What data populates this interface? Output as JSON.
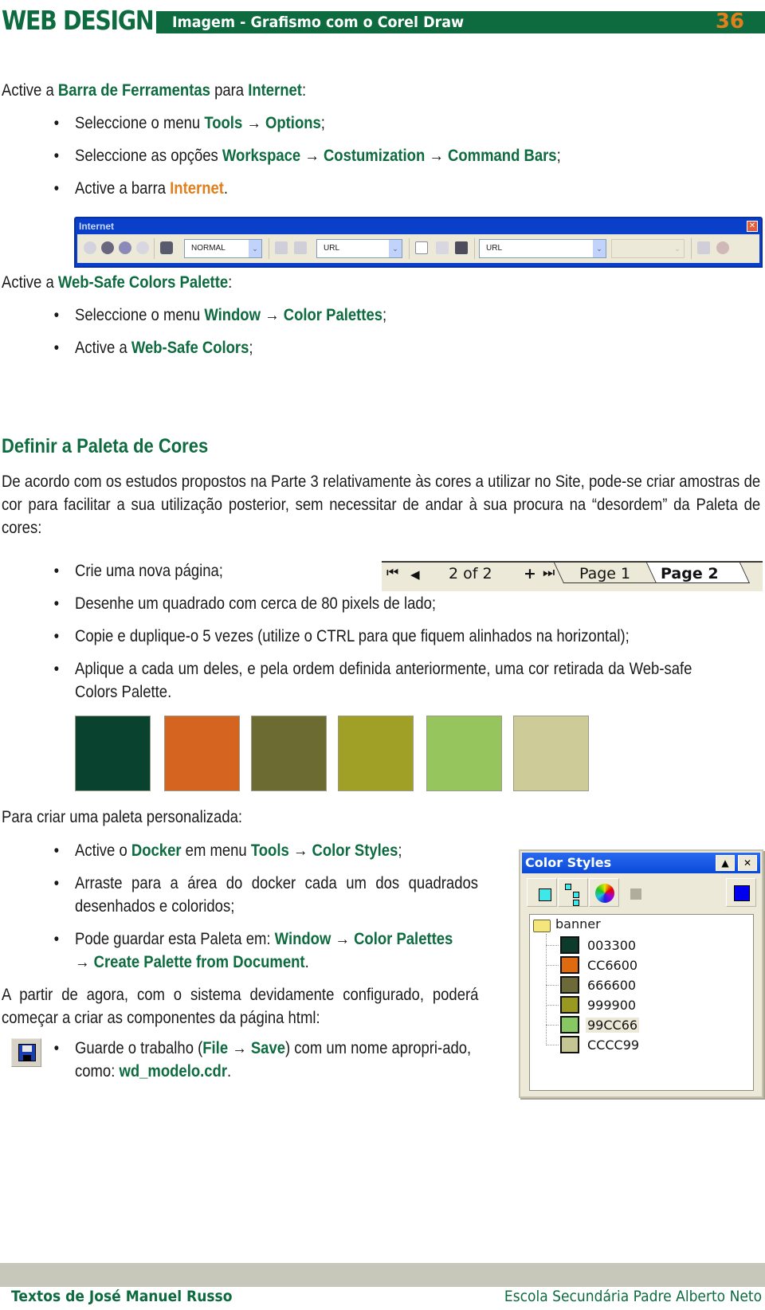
{
  "header": {
    "brand": "WEB DESIGN",
    "subtitle": "Imagem - Grafismo com o Corel Draw",
    "page_number": "36"
  },
  "section1": {
    "intro": [
      "Active a ",
      "Barra de Ferramentas",
      " para ",
      "Internet",
      ":"
    ],
    "bullets": [
      [
        "Seleccione o menu ",
        "Tools",
        " → ",
        "Options",
        ";"
      ],
      [
        "Seleccione as opções ",
        "Workspace",
        " → ",
        "Costumization",
        " → ",
        "Command Bars",
        ";"
      ],
      [
        "Active a barra ",
        "Internet",
        "."
      ]
    ]
  },
  "internet_toolbar": {
    "title": "Internet",
    "close_glyph": "✕",
    "combo_style": "NORMAL",
    "combo_url_icon_label": "URL",
    "combo_url": "URL",
    "dropdown_glyph": "⌄"
  },
  "section2": {
    "intro": [
      "Active a ",
      "Web-Safe Colors Palette",
      ":"
    ],
    "bullets": [
      [
        "Seleccione o menu ",
        "Window",
        " → ",
        "Color Palettes",
        ";"
      ],
      [
        "Active a ",
        "Web-Safe Colors",
        ";"
      ]
    ]
  },
  "section3": {
    "heading": "Definir a Paleta de Cores",
    "paragraph": "De acordo com os estudos propostos na Parte 3 relativamente às cores a utilizar no Site, pode-se criar amostras de cor para facilitar a sua utilização posterior, sem necessitar de andar à sua procura na “desordem” da Paleta de cores:",
    "bullets": [
      "Crie uma nova página;",
      "Desenhe um quadrado com cerca de 80 pixels de lado;",
      "Copie e duplique-o 5 vezes (utilize o CTRL para que fiquem alinhados na horizontal);",
      "Aplique a cada um deles, e pela ordem definida anteriormente, uma cor retirada da Web-safe Colors Palette."
    ]
  },
  "page_navigator": {
    "first_glyph": "⏮",
    "prev_glyph": "◀",
    "counter": "2 of 2",
    "add_glyph": "+",
    "last_glyph": "⏭",
    "tabs": [
      "Page 1",
      "Page 2"
    ],
    "active_tab": "Page 2"
  },
  "swatches": [
    "#0a4230",
    "#d46420",
    "#6c6b32",
    "#a0a027",
    "#96c55e",
    "#cdcb98"
  ],
  "section4": {
    "intro": "Para criar uma paleta personalizada:",
    "bullets": [
      [
        "Active o ",
        "Docker",
        " em menu ",
        "Tools",
        " → ",
        "Color Styles",
        ";"
      ],
      [
        "Arraste para a área do docker cada um dos quadrados desenhados e coloridos;"
      ],
      [
        "Pode guardar esta Paleta em: ",
        "Window",
        " → ",
        "Color Palettes",
        " → ",
        "Create Palette from Document",
        "."
      ]
    ]
  },
  "color_styles": {
    "title": "Color Styles",
    "up_glyph": "▲",
    "close_glyph": "✕",
    "folder": "banner",
    "items": [
      {
        "label": "003300",
        "color": "#0c3b2c"
      },
      {
        "label": "CC6600",
        "color": "#e06a10"
      },
      {
        "label": "666600",
        "color": "#6b6a38"
      },
      {
        "label": "999900",
        "color": "#999922"
      },
      {
        "label": "99CC66",
        "color": "#88c862"
      },
      {
        "label": "CCCC99",
        "color": "#c6c695"
      }
    ],
    "selected": "99CC66"
  },
  "section5": {
    "paragraph": "A partir de agora, com o sistema devidamente configurado, poderá começar a criar as componentes da página html:",
    "bullet": [
      "Guarde o trabalho (",
      "File",
      " → ",
      "Save",
      ") com um nome apropri-ado, como: ",
      "wd_modelo.cdr",
      "."
    ]
  },
  "footer": {
    "left": "Textos de José Manuel Russo",
    "right": "Escola Secundária Padre Alberto Neto"
  },
  "colors": {
    "brand_green": "#0d6b3f",
    "accent_orange": "#e07f1c"
  }
}
